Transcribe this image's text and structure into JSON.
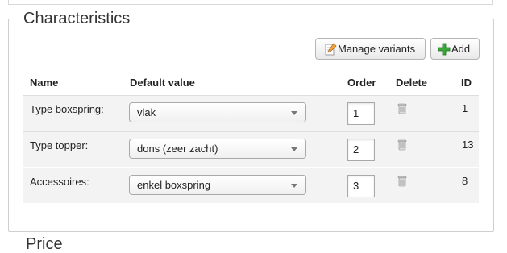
{
  "section": {
    "title": "Characteristics",
    "next_title": "Price"
  },
  "toolbar": {
    "manage_label": "Manage variants",
    "add_label": "Add"
  },
  "table": {
    "headers": {
      "name": "Name",
      "default": "Default value",
      "order": "Order",
      "delete": "Delete",
      "id": "ID"
    },
    "rows": [
      {
        "name": "Type boxspring:",
        "default": "vlak",
        "order": "1",
        "id": "1"
      },
      {
        "name": "Type topper:",
        "default": "dons (zeer zacht)",
        "order": "2",
        "id": "13"
      },
      {
        "name": "Accessoires:",
        "default": "enkel boxspring",
        "order": "3",
        "id": "8"
      }
    ]
  },
  "icons": {
    "manage": "pencil-paper-icon",
    "add": "green-plus-icon",
    "delete": "trash-icon"
  }
}
